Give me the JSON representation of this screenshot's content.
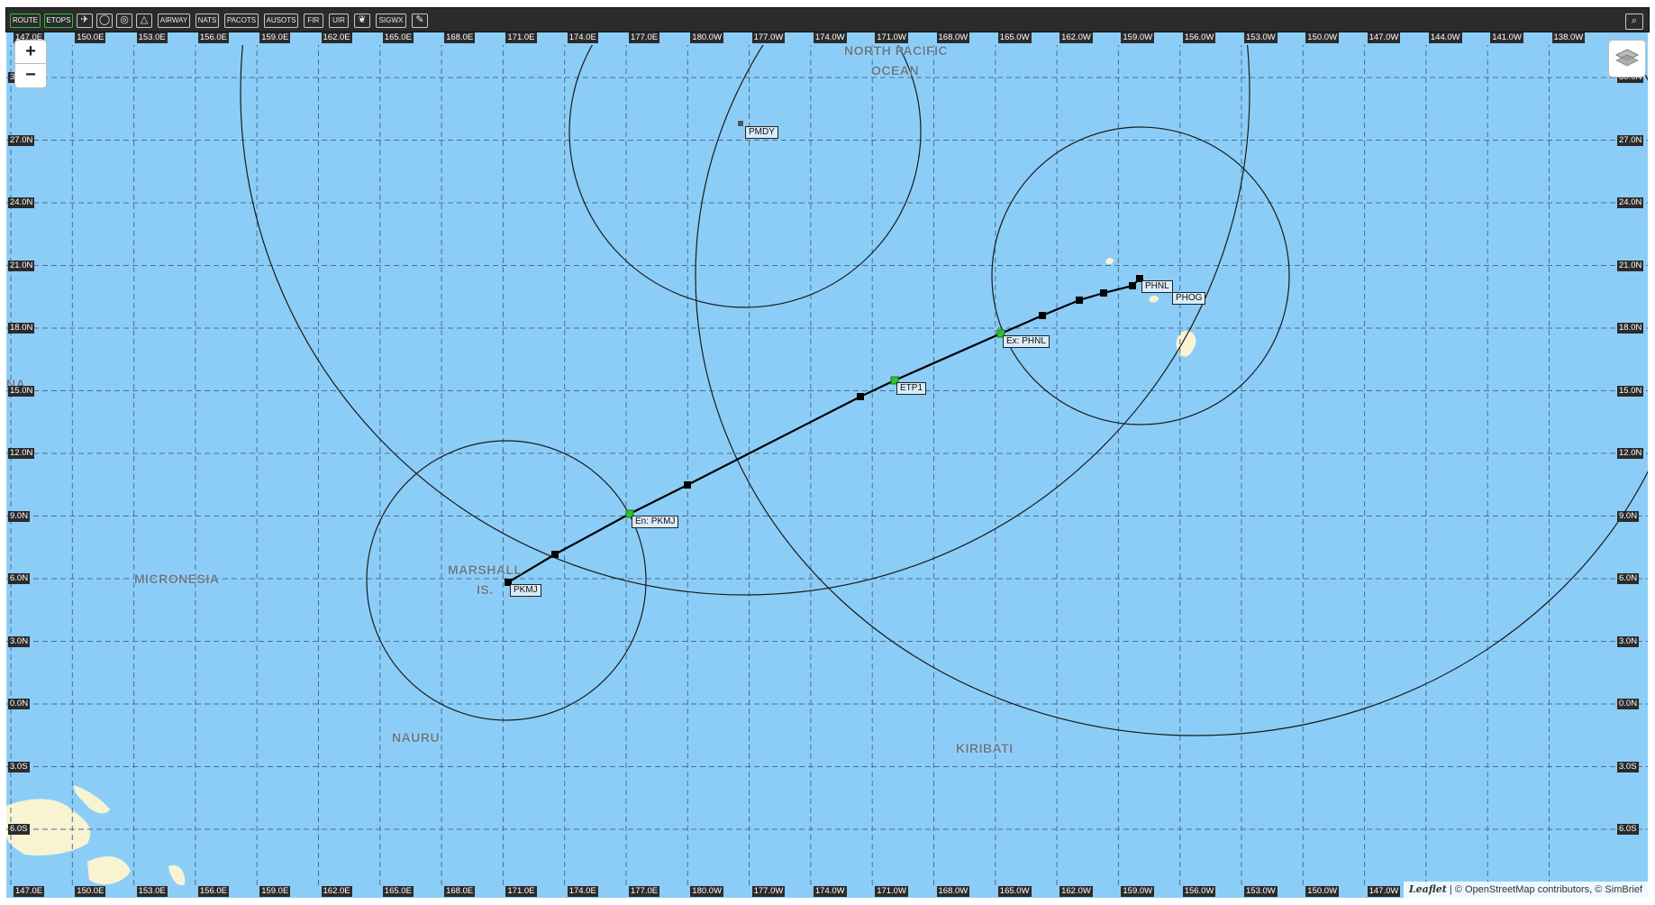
{
  "toolbar": {
    "buttons": [
      {
        "label": "ROUTE",
        "active": true
      },
      {
        "label": "ETOPS",
        "active": true
      },
      {
        "label": "",
        "icon": "satellite-icon"
      },
      {
        "label": "",
        "icon": "circle-icon"
      },
      {
        "label": "",
        "icon": "target-icon"
      },
      {
        "label": "",
        "icon": "triangle-icon"
      },
      {
        "label": "AIRWAY"
      },
      {
        "label": "NATS"
      },
      {
        "label": "PACOTS"
      },
      {
        "label": "AUSOTS"
      },
      {
        "label": "FIR"
      },
      {
        "label": "UIR"
      },
      {
        "label": "",
        "icon": "leaf-icon"
      },
      {
        "label": "SIGWX"
      },
      {
        "label": "",
        "icon": "wrench-icon"
      }
    ],
    "search_icon": "search-icon"
  },
  "zoom": {
    "in_label": "+",
    "out_label": "−"
  },
  "layers_icon": "layers-icon",
  "grid": {
    "lon_labels": [
      "147.0E",
      "150.0E",
      "153.0E",
      "156.0E",
      "159.0E",
      "162.0E",
      "165.0E",
      "168.0E",
      "171.0E",
      "174.0E",
      "177.0E",
      "180.0W",
      "177.0W",
      "174.0W",
      "171.0W",
      "168.0W",
      "165.0W",
      "162.0W",
      "159.0W",
      "156.0W",
      "153.0W",
      "150.0W",
      "147.0W",
      "144.0W",
      "141.0W",
      "138.0W"
    ],
    "bottom_lon_labels": [
      "147.0E",
      "150.0E",
      "153.0E",
      "156.0E",
      "159.0E",
      "162.0E",
      "165.0E",
      "168.0E",
      "171.0E",
      "174.0E",
      "177.0E",
      "180.0W",
      "177.0W",
      "174.0W",
      "171.0W",
      "168.0W",
      "165.0W",
      "162.0W",
      "159.0W",
      "156.0W",
      "153.0W",
      "150.0W",
      "147.0W"
    ],
    "lat_labels": [
      "30.0N",
      "27.0N",
      "24.0N",
      "21.0N",
      "18.0N",
      "15.0N",
      "12.0N",
      "9.0N",
      "6.0N",
      "3.0N",
      "0.0N",
      "3.0S",
      "6.0S"
    ]
  },
  "regions": [
    {
      "text": "NORTH PACIFIC",
      "text2": "OCEAN"
    },
    {
      "text": "MICRONESIA"
    },
    {
      "text": "MARSHALL",
      "text2": "IS."
    },
    {
      "text": "NAURU"
    },
    {
      "text": "KIRIBATI"
    },
    {
      "text": "NA"
    }
  ],
  "waypoints": [
    {
      "label": "PKMJ"
    },
    {
      "label": "En: PKMJ"
    },
    {
      "label": "ETP1"
    },
    {
      "label": "Ex: PHNL"
    },
    {
      "label": "PHNL"
    },
    {
      "label": "PHOG"
    },
    {
      "label": "PMDY"
    }
  ],
  "attribution": {
    "leaflet": "Leaflet",
    "text": "| © OpenStreetMap contributors, © SimBrief"
  },
  "colors": {
    "ocean": "#8ccdf8",
    "land": "#f8f4d2",
    "route": "#000000",
    "etops_point": "#2fbf2f"
  }
}
